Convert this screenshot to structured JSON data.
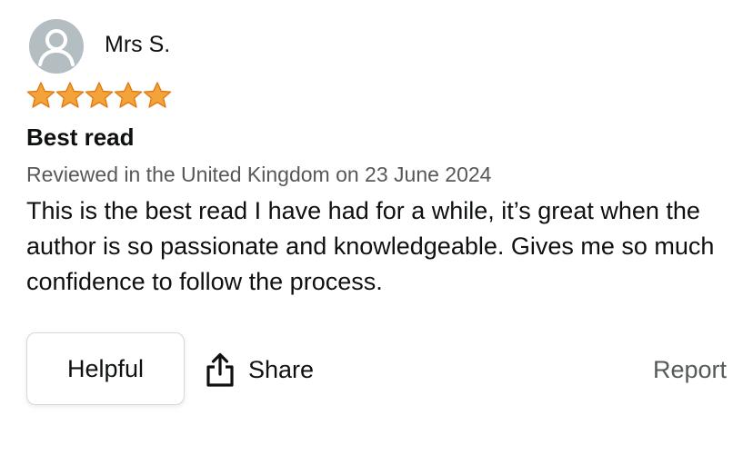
{
  "reviewer": {
    "name": "Mrs S.",
    "avatar_icon": "user-silhouette-icon"
  },
  "rating": {
    "value": 5,
    "max": 5,
    "star_color": "#f2a33a",
    "star_outline": "#e47911"
  },
  "review": {
    "title": "Best read",
    "meta": "Reviewed in the United Kingdom on 23 June 2024",
    "body": "This is the best read I have had for a while, it’s great when the author is so passionate and knowledgeable. Gives me so much confidence to follow the process."
  },
  "actions": {
    "helpful_label": "Helpful",
    "share_label": "Share",
    "share_icon": "share-upload-icon",
    "report_label": "Report"
  }
}
